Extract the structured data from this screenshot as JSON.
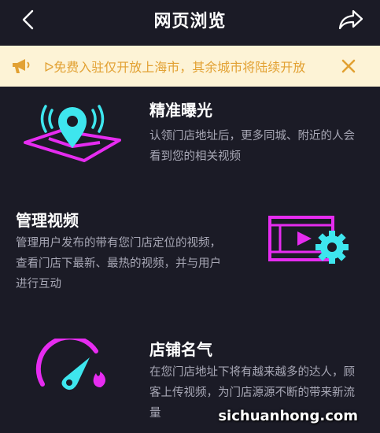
{
  "header": {
    "title": "网页浏览",
    "back_icon": "chevron-left-icon",
    "share_icon": "share-arrow-icon"
  },
  "notice": {
    "text": "ᐅ免费入驻仅开放上海市，其余城市将陆续开放",
    "icon": "megaphone-icon",
    "close_icon": "close-icon",
    "background": "#fdf3d6",
    "text_color": "#e2a133"
  },
  "features": [
    {
      "title": "精准曝光",
      "description": "认领门店地址后，更多同城、附近的人会看到您的相关视频",
      "icon": "location-map-icon"
    },
    {
      "title": "管理视频",
      "description": "管理用户发布的带有您门店定位的视频，查看门店下最新、最热的视频，并与用户进行互动",
      "icon": "video-settings-icon"
    },
    {
      "title": "店铺名气",
      "description": "在您门店地址下将有越来越多的达人，顾客上传视频，为门店源源不断的带来新流量",
      "icon": "speedometer-fire-icon"
    }
  ],
  "colors": {
    "background": "#1b1b26",
    "accent_cyan": "#3ee6ee",
    "accent_magenta": "#e62cf0"
  },
  "watermark": "sichuanhong.com"
}
